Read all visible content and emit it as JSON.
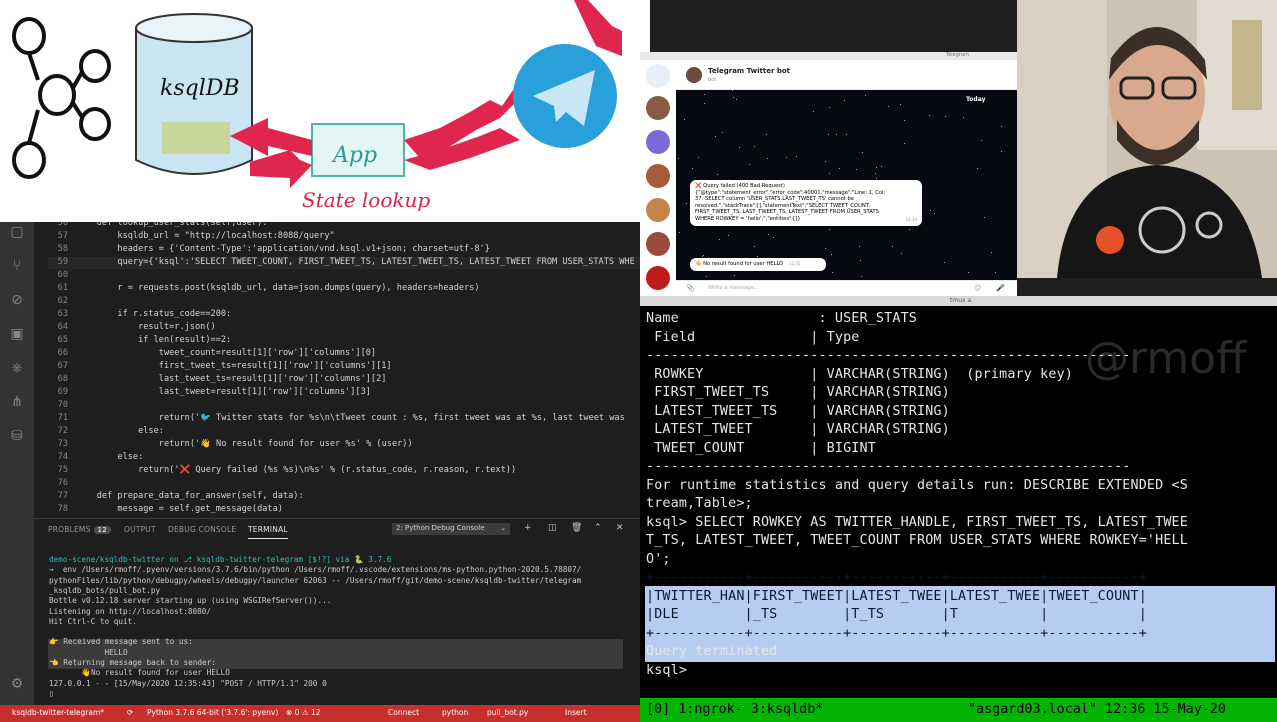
{
  "editor": {
    "lines": [
      {
        "n": "56",
        "text": "    def lookup_user_stats(self,user):"
      },
      {
        "n": "57",
        "text": "        ksqldb_url = \"http://localhost:8088/query\""
      },
      {
        "n": "58",
        "text": "        headers = {'Content-Type':'application/vnd.ksql.v1+json; charset=utf-8'}"
      },
      {
        "n": "59",
        "text": "        query={'ksql':'SELECT TWEET_COUNT, FIRST_TWEET_TS, LATEST_TWEET_TS, LATEST_TWEET FROM USER_STATS WHE"
      },
      {
        "n": "60",
        "text": ""
      },
      {
        "n": "61",
        "text": "        r = requests.post(ksqldb_url, data=json.dumps(query), headers=headers)"
      },
      {
        "n": "62",
        "text": ""
      },
      {
        "n": "63",
        "text": "        if r.status_code==200:"
      },
      {
        "n": "64",
        "text": "            result=r.json()"
      },
      {
        "n": "65",
        "text": "            if len(result)==2:"
      },
      {
        "n": "66",
        "text": "                tweet_count=result[1]['row']['columns'][0]"
      },
      {
        "n": "67",
        "text": "                first_tweet_ts=result[1]['row']['columns'][1]"
      },
      {
        "n": "68",
        "text": "                last_tweet_ts=result[1]['row']['columns'][2]"
      },
      {
        "n": "69",
        "text": "                last_tweet=result[1]['row']['columns'][3]"
      },
      {
        "n": "70",
        "text": ""
      },
      {
        "n": "71",
        "text": "                return('🐦 Twitter stats for %s\\n\\tTweet count : %s, first tweet was at %s, last tweet was"
      },
      {
        "n": "72",
        "text": "            else:"
      },
      {
        "n": "73",
        "text": "                return('👋 No result found for user %s' % (user))"
      },
      {
        "n": "74",
        "text": "        else:"
      },
      {
        "n": "75",
        "text": "            return('❌ Query failed (%s %s)\\n%s' % (r.status_code, r.reason, r.text))"
      },
      {
        "n": "76",
        "text": ""
      },
      {
        "n": "77",
        "text": "    def prepare_data_for_answer(self, data):"
      },
      {
        "n": "78",
        "text": "        message = self.get_message(data)"
      }
    ]
  },
  "panel": {
    "tabs": {
      "problems": "PROBLEMS",
      "problems_count": "12",
      "output": "OUTPUT",
      "debug": "DEBUG CONSOLE",
      "terminal": "TERMINAL"
    },
    "terminal_select": "2: Python Debug Console",
    "lines": [
      "demo-scene/ksqldb-twitter on ⎇ ksqldb-twitter-telegram [$!?] via 🐍 3.7.6",
      "→  env /Users/rmoff/.pyenv/versions/3.7.6/bin/python /Users/rmoff/.vscode/extensions/ms-python.python-2020.5.78807/",
      "pythonFiles/lib/python/debugpy/wheels/debugpy/launcher 62063 -- /Users/rmoff/git/demo-scene/ksqldb-twitter/telegram",
      "_ksqldb_bots/pull_bot.py",
      "Bottle v0.12.18 server starting up (using WSGIRefServer())...",
      "Listening on http://localhost:8080/",
      "Hit Ctrl-C to quit.",
      "",
      "👉 Received message sent to us:",
      "            HELLO",
      "👈 Returning message back to sender:",
      "       👋No result found for user HELLO",
      "127.0.0.1 - - [15/May/2020 12:35:43] \"POST / HTTP/1.1\" 200 0",
      "▯"
    ]
  },
  "statusbar": {
    "branch": "ksqldb-twitter-telegram*",
    "sync": "⟳",
    "python": "Python 3.7.6 64-bit ('3.7.6': pyenv)",
    "errors": "⊗ 0 ⚠ 12",
    "connect": "Connect",
    "lang": "python",
    "file": "pull_bot.py",
    "insert": "Insert"
  },
  "diagram": {
    "ksqldb_label": "ksqlDB",
    "app_label": "App",
    "state_lookup": "State lookup"
  },
  "telegram": {
    "title": "Telegram",
    "chat_name": "Telegram Twitter bot",
    "chat_sub": "bot",
    "date": "Today",
    "error_bubble": [
      "❌ Query failed (400 Bad Request)",
      "{\"@type\":\"statement_error\",\"error_code\":40001,\"message\":\"Line: 1, Col:",
      "37: SELECT column 'USER_STATS.LAST_TWEET_TS' cannot be",
      "resolved.\",\"stackTrace\":[],\"statementText\":\"SELECT TWEET_COUNT,",
      "FIRST_TWEET_TS, LAST_TWEET_TS, LATEST_TWEET FROM USER_STATS",
      "WHERE ROWKEY = 'hello';\",\"entities\":[]}"
    ],
    "error_time": "12:34",
    "no_result": "👋 No result found for user HELLO",
    "no_result_time": "12:35",
    "input_placeholder": "Write a message..."
  },
  "tmux": {
    "title": "tmux a",
    "watermark": "@rmoff",
    "lines": [
      "Name                 : USER_STATS",
      " Field              | Type",
      "-----------------------------------------------------------",
      " ROWKEY             | VARCHAR(STRING)  (primary key)",
      " FIRST_TWEET_TS     | VARCHAR(STRING)",
      " LATEST_TWEET_TS    | VARCHAR(STRING)",
      " LATEST_TWEET       | VARCHAR(STRING)",
      " TWEET_COUNT        | BIGINT",
      "-----------------------------------------------------------",
      "For runtime statistics and query details run: DESCRIBE EXTENDED <S",
      "tream,Table>;",
      "ksql> SELECT ROWKEY AS TWITTER_HANDLE, FIRST_TWEET_TS, LATEST_TWEE",
      "T_TS, LATEST_TWEET, TWEET_COUNT FROM USER_STATS WHERE ROWKEY='HELL",
      "O';",
      "+-----------+-----------+-----------+-----------+-----------+",
      "|TWITTER_HAN|FIRST_TWEET|LATEST_TWEE|LATEST_TWEE|TWEET_COUNT|",
      "|DLE        |_TS        |T_TS       |T          |           |",
      "+-----------+-----------+-----------+-----------+-----------+",
      "Query terminated",
      "ksql> "
    ],
    "status_left": "[0] 1:ngrok- 3:ksqldb*",
    "status_right": "\"asgard03.local\" 12:36 15-May-20"
  }
}
